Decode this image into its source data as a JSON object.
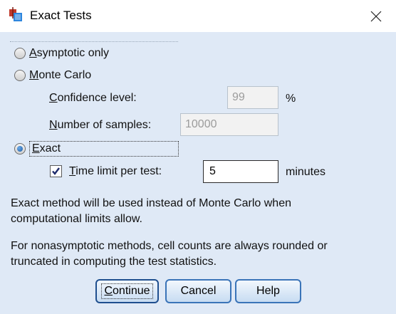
{
  "window": {
    "title": "Exact Tests",
    "close_icon": "close-icon",
    "app_icon": "spss-app-icon"
  },
  "options": {
    "asymptotic": {
      "mnemonic": "A",
      "rest": "symptotic only",
      "selected": false
    },
    "monte_carlo": {
      "mnemonic": "M",
      "rest": "onte Carlo",
      "selected": false
    },
    "exact": {
      "mnemonic": "E",
      "rest": "xact",
      "selected": true
    }
  },
  "monte_carlo_fields": {
    "confidence_label_mn": "C",
    "confidence_label_rest": "onfidence level:",
    "confidence_value": "99",
    "confidence_unit": "%",
    "samples_label_mn": "N",
    "samples_label_rest": "umber of samples:",
    "samples_value": "10000"
  },
  "exact_fields": {
    "time_limit_checked": true,
    "time_limit_label_mn": "T",
    "time_limit_label_rest": "ime limit per test:",
    "time_limit_value": "5",
    "time_limit_unit": "minutes"
  },
  "info": {
    "line1": "Exact method will be used instead of Monte Carlo when",
    "line2": "computational limits allow.",
    "line3": "For nonasymptotic methods, cell counts are always rounded or",
    "line4": "truncated in computing the test statistics."
  },
  "buttons": {
    "continue_mn": "C",
    "continue_rest": "ontinue",
    "cancel": "Cancel",
    "help": "Help"
  },
  "colors": {
    "dialog_bg": "#dfe9f6",
    "button_border": "#3a74b8"
  }
}
